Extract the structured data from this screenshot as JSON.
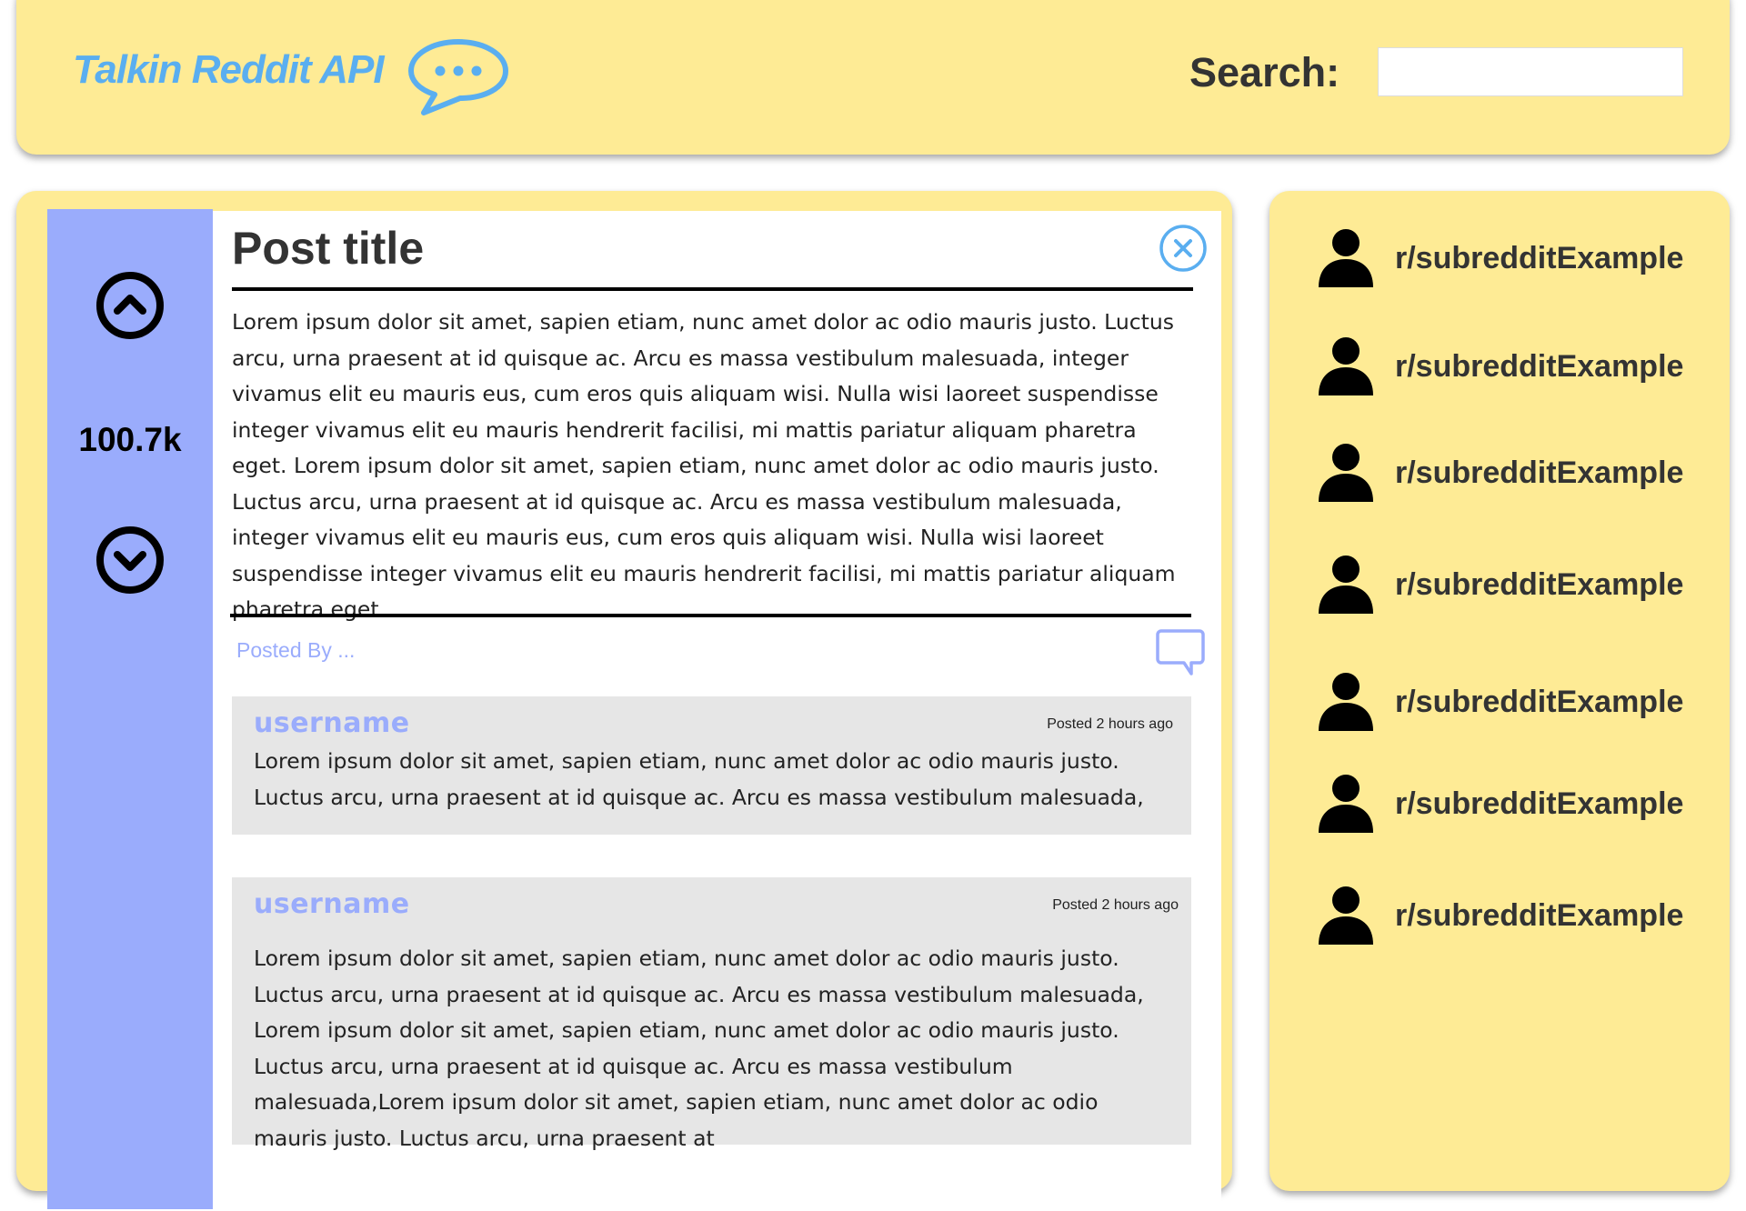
{
  "header": {
    "logo_text": "Talkin Reddit API",
    "logo_icon": "chat-bubble-dots-icon",
    "search_label": "Search:",
    "search_value": ""
  },
  "post": {
    "score": "100.7k",
    "title": "Post title",
    "body": "Lorem ipsum dolor sit amet, sapien etiam, nunc amet dolor ac odio mauris justo. Luctus arcu, urna praesent at id quisque ac. Arcu es massa vestibulum malesuada, integer vivamus elit eu mauris eus, cum eros quis aliquam wisi. Nulla wisi laoreet suspendisse integer vivamus elit eu mauris hendrerit facilisi, mi mattis pariatur aliquam pharetra eget. Lorem ipsum dolor sit amet, sapien etiam, nunc amet dolor ac odio mauris justo. Luctus arcu, urna praesent at id quisque ac. Arcu es massa vestibulum malesuada, integer vivamus elit eu mauris eus, cum eros quis aliquam wisi. Nulla wisi laoreet suspendisse integer vivamus elit eu mauris hendrerit facilisi, mi mattis pariatur aliquam pharetra eget.",
    "posted_by": "Posted By ..."
  },
  "comments": [
    {
      "username": "username",
      "time": "Posted 2 hours ago",
      "text": "Lorem ipsum dolor sit amet, sapien etiam, nunc amet dolor ac odio mauris justo. Luctus arcu, urna praesent at id quisque ac. Arcu es massa vestibulum malesuada,"
    },
    {
      "username": "username",
      "time": "Posted 2 hours ago",
      "text": "Lorem ipsum dolor sit amet, sapien etiam, nunc amet dolor ac odio mauris justo. Luctus arcu, urna praesent at id quisque ac. Arcu es massa vestibulum malesuada, Lorem ipsum dolor sit amet, sapien etiam, nunc amet dolor ac odio mauris justo. Luctus arcu, urna praesent at id quisque ac. Arcu es massa vestibulum malesuada,Lorem ipsum dolor sit amet, sapien etiam, nunc amet dolor ac odio mauris justo. Luctus arcu, urna praesent at"
    }
  ],
  "sidebar": {
    "subreddits": [
      "r/subredditExample",
      "r/subredditExample",
      "r/subredditExample",
      "r/subredditExample",
      "r/subredditExample",
      "r/subredditExample",
      "r/subredditExample"
    ]
  },
  "colors": {
    "panel": "#feeb95",
    "vote_column": "#9aacfc",
    "logo": "#5aaef0",
    "comment_bg": "#e6e6e6"
  }
}
